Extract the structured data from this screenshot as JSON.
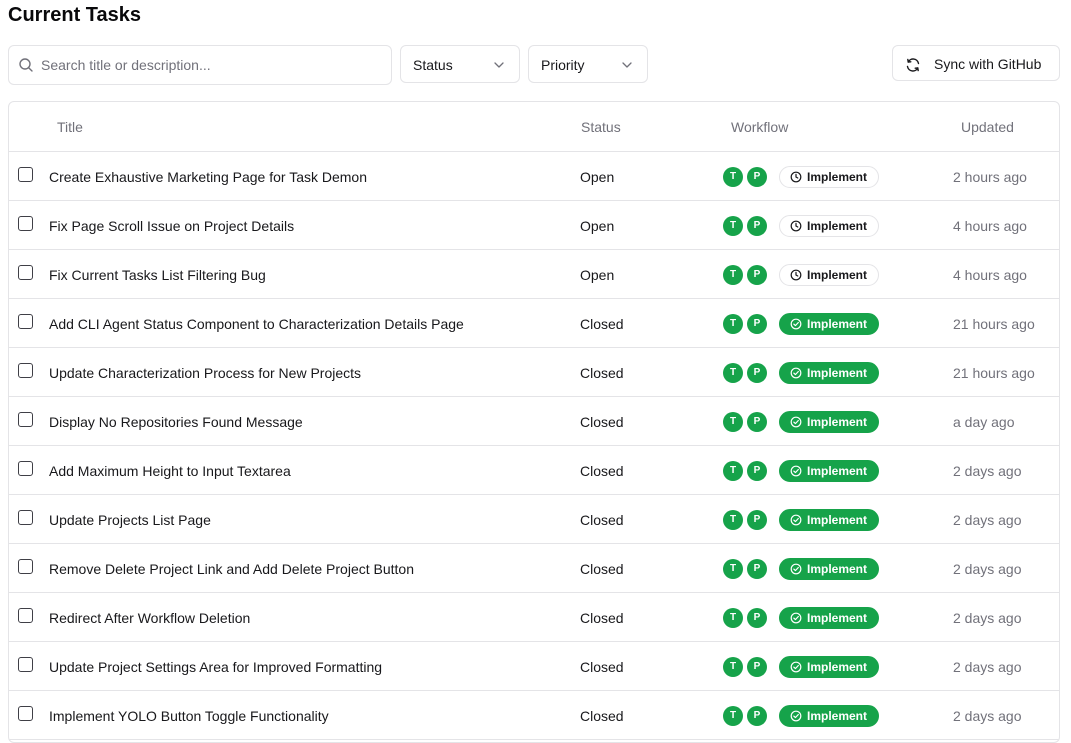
{
  "page": {
    "title": "Current Tasks"
  },
  "toolbar": {
    "search_placeholder": "Search title or description...",
    "status_label": "Status",
    "priority_label": "Priority",
    "sync_label": "Sync with GitHub"
  },
  "table": {
    "headers": {
      "title": "Title",
      "status": "Status",
      "workflow": "Workflow",
      "updated": "Updated"
    },
    "rows": [
      {
        "title": "Create Exhaustive Marketing Page for Task Demon",
        "status": "Open",
        "avatar1": "T",
        "avatar2": "P",
        "workflow": "Implement",
        "updated": "2 hours ago"
      },
      {
        "title": "Fix Page Scroll Issue on Project Details",
        "status": "Open",
        "avatar1": "T",
        "avatar2": "P",
        "workflow": "Implement",
        "updated": "4 hours ago"
      },
      {
        "title": "Fix Current Tasks List Filtering Bug",
        "status": "Open",
        "avatar1": "T",
        "avatar2": "P",
        "workflow": "Implement",
        "updated": "4 hours ago"
      },
      {
        "title": "Add CLI Agent Status Component to Characterization Details Page",
        "status": "Closed",
        "avatar1": "T",
        "avatar2": "P",
        "workflow": "Implement",
        "updated": "21 hours ago"
      },
      {
        "title": "Update Characterization Process for New Projects",
        "status": "Closed",
        "avatar1": "T",
        "avatar2": "P",
        "workflow": "Implement",
        "updated": "21 hours ago"
      },
      {
        "title": "Display No Repositories Found Message",
        "status": "Closed",
        "avatar1": "T",
        "avatar2": "P",
        "workflow": "Implement",
        "updated": "a day ago"
      },
      {
        "title": "Add Maximum Height to Input Textarea",
        "status": "Closed",
        "avatar1": "T",
        "avatar2": "P",
        "workflow": "Implement",
        "updated": "2 days ago"
      },
      {
        "title": "Update Projects List Page",
        "status": "Closed",
        "avatar1": "T",
        "avatar2": "P",
        "workflow": "Implement",
        "updated": "2 days ago"
      },
      {
        "title": "Remove Delete Project Link and Add Delete Project Button",
        "status": "Closed",
        "avatar1": "T",
        "avatar2": "P",
        "workflow": "Implement",
        "updated": "2 days ago"
      },
      {
        "title": "Redirect After Workflow Deletion",
        "status": "Closed",
        "avatar1": "T",
        "avatar2": "P",
        "workflow": "Implement",
        "updated": "2 days ago"
      },
      {
        "title": "Update Project Settings Area for Improved Formatting",
        "status": "Closed",
        "avatar1": "T",
        "avatar2": "P",
        "workflow": "Implement",
        "updated": "2 days ago"
      },
      {
        "title": "Implement YOLO Button Toggle Functionality",
        "status": "Closed",
        "avatar1": "T",
        "avatar2": "P",
        "workflow": "Implement",
        "updated": "2 days ago"
      }
    ]
  },
  "colors": {
    "accent_green": "#16a34a",
    "border": "#e4e4e7",
    "muted_text": "#71717a"
  },
  "icons": {
    "search": "search-icon",
    "chevron": "chevron-down-icon",
    "sync": "refresh-icon",
    "open_workflow": "clock-icon",
    "closed_workflow": "check-circle-icon"
  }
}
